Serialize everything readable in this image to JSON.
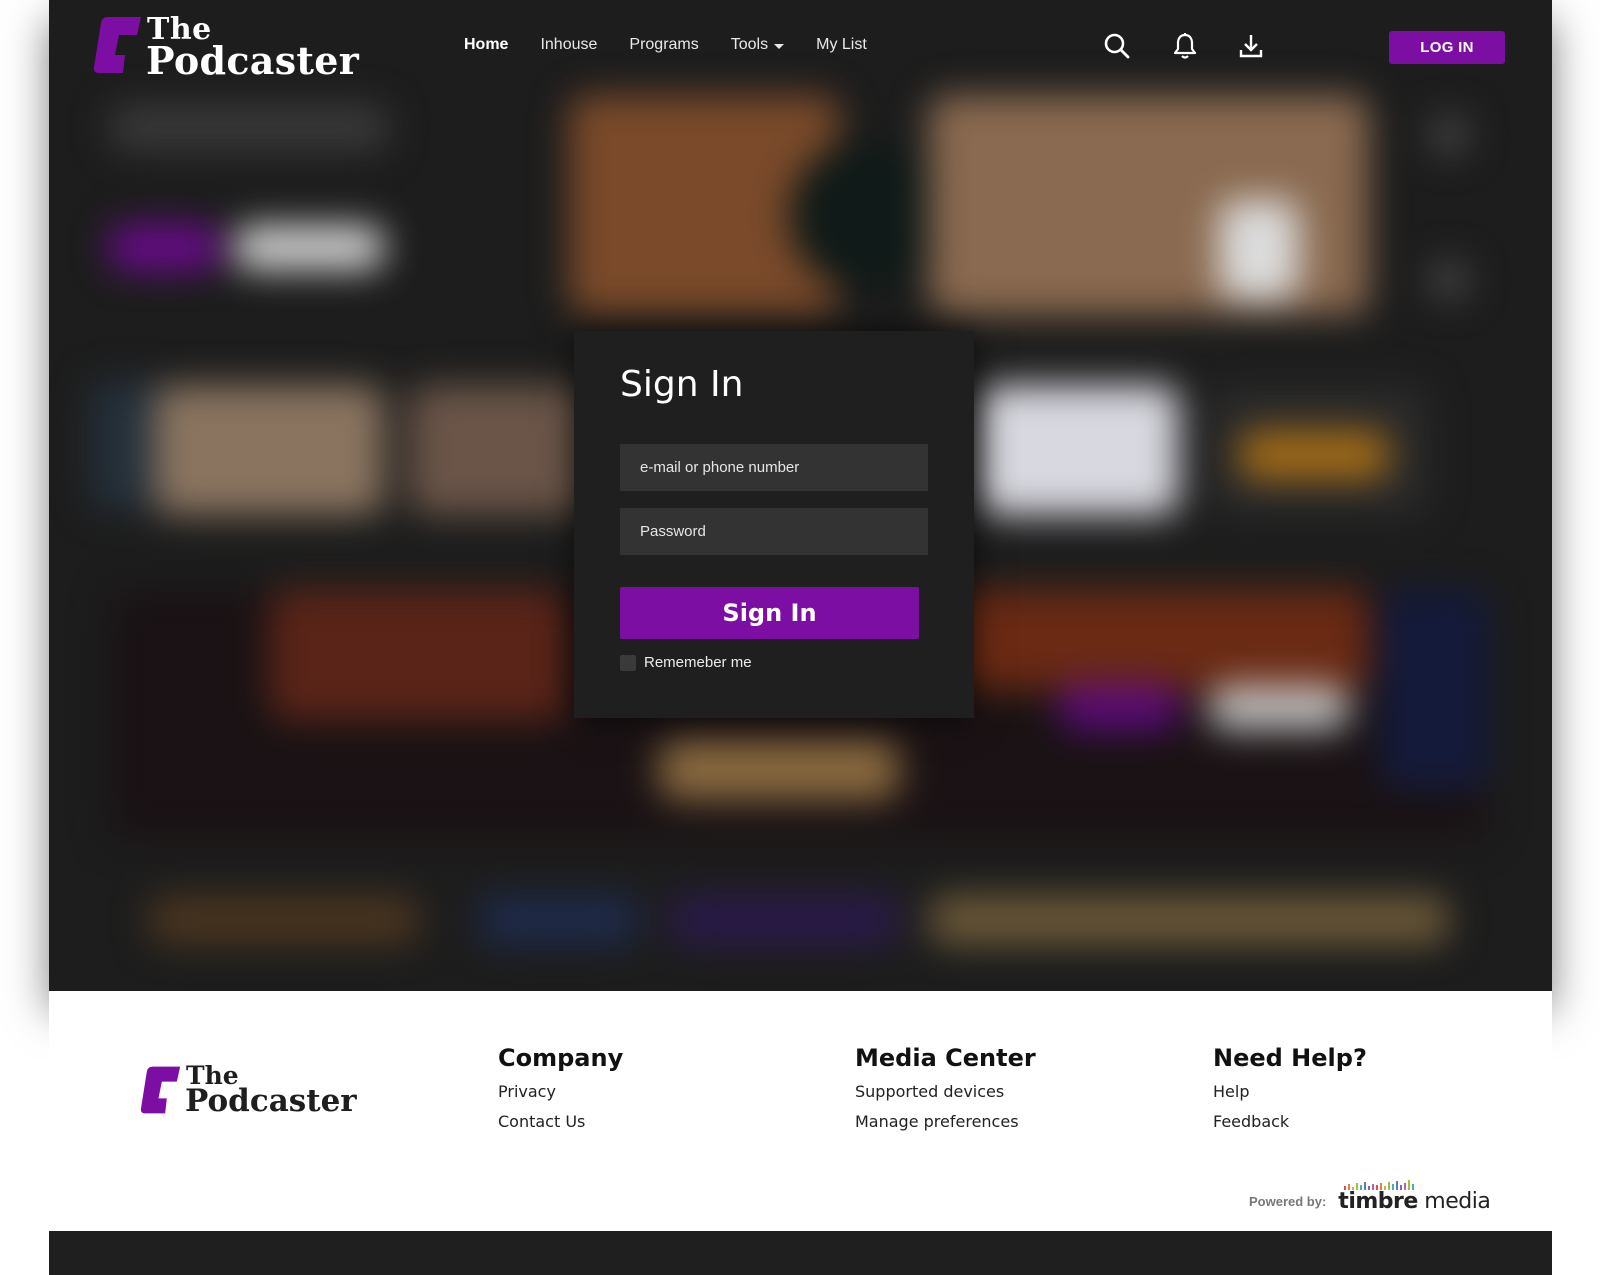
{
  "brand": {
    "line1": "The",
    "line2": "Podcaster",
    "accent": "#7c0ea3"
  },
  "nav": {
    "items": [
      {
        "label": "Home",
        "active": true
      },
      {
        "label": "Inhouse"
      },
      {
        "label": "Programs"
      },
      {
        "label": "Tools",
        "dropdown": true
      },
      {
        "label": "My List"
      }
    ],
    "icons": [
      "search-icon",
      "bell-icon",
      "download-icon"
    ],
    "login_label": "LOG IN"
  },
  "signin": {
    "title": "Sign In",
    "email_placeholder": "e-mail or phone number",
    "password_placeholder": "Password",
    "submit_label": "Sign In",
    "remember_label": "Rememeber me"
  },
  "footer": {
    "columns": [
      {
        "title": "Company",
        "links": [
          "Privacy",
          "Contact Us"
        ]
      },
      {
        "title": "Media Center",
        "links": [
          "Supported devices",
          "Manage preferences"
        ]
      },
      {
        "title": "Need Help?",
        "links": [
          "Help",
          "Feedback"
        ]
      }
    ],
    "powered_by_label": "Powered by:",
    "powered_by_brand_bold": "timbre",
    "powered_by_brand_light": " media"
  }
}
